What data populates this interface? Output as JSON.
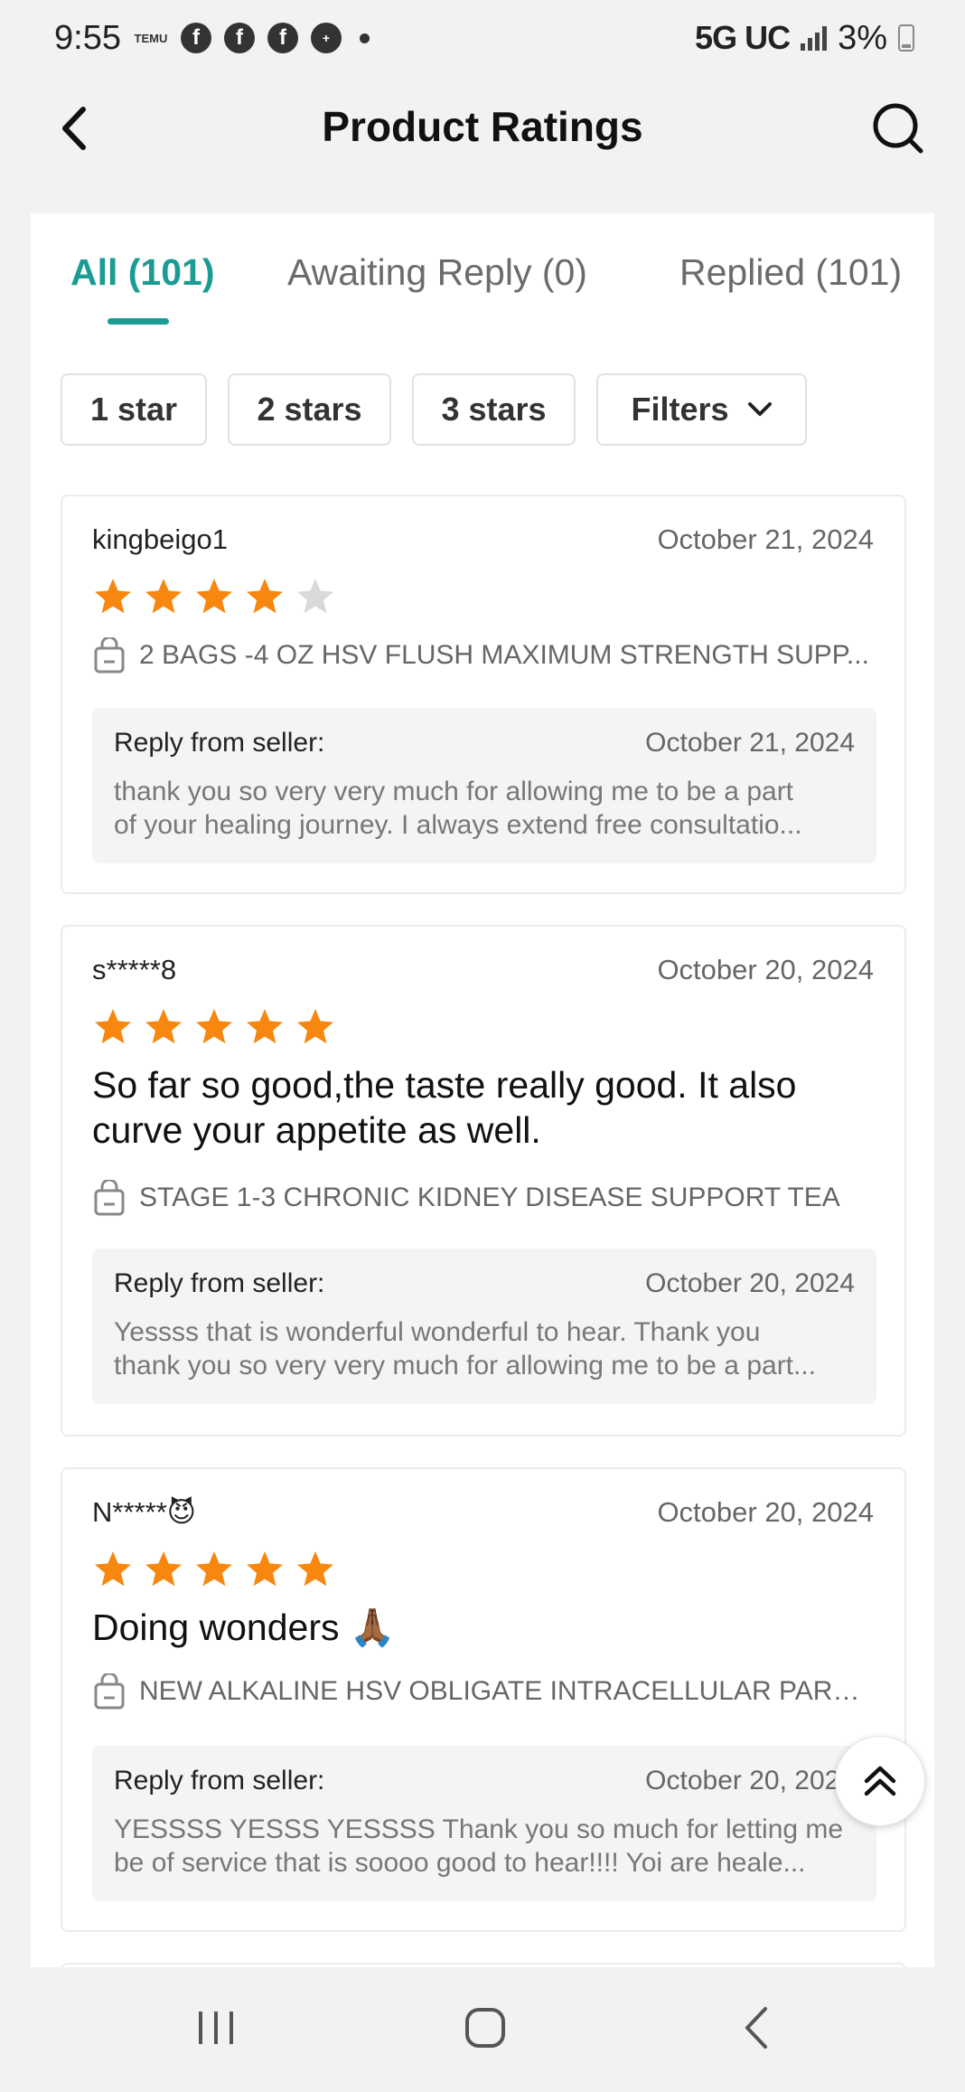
{
  "status_bar": {
    "time": "9:55",
    "temu_label": "TEMU",
    "network": "5G UC",
    "battery": "3%",
    "app_icons": [
      "temu-icon",
      "facebook-icon",
      "facebook-icon",
      "facebook-icon",
      "app-icon"
    ]
  },
  "header": {
    "title": "Product Ratings",
    "back_icon": "chevron-left-icon",
    "search_icon": "search-icon"
  },
  "tabs": [
    {
      "label": "All (101)",
      "active": true
    },
    {
      "label": "Awaiting Reply (0)",
      "active": false
    },
    {
      "label": "Replied (101)",
      "active": false
    }
  ],
  "filters": {
    "chips": [
      "1 star",
      "2 stars",
      "3 stars"
    ],
    "filters_label": "Filters"
  },
  "reviews": [
    {
      "user": "kingbeigo1",
      "date": "October 21, 2024",
      "rating": 4,
      "text": "",
      "product": "2 BAGS -4 OZ HSV FLUSH MAXIMUM STRENGTH SUPP...",
      "reply_label": "Reply from seller:",
      "reply_date": "October 21, 2024",
      "reply_line1": "thank you so very very much for allowing me to be a part",
      "reply_line2": "of your healing journey.  I always extend free consultatio..."
    },
    {
      "user": "s*****8",
      "date": "October 20, 2024",
      "rating": 5,
      "text": "So far so good,the taste really good.  It also curve your appetite as well.",
      "product": "STAGE 1-3 CHRONIC KIDNEY DISEASE SUPPORT TEA",
      "reply_label": "Reply from seller:",
      "reply_date": "October 20, 2024",
      "reply_line1": "Yessss that is wonderful wonderful to hear. Thank you",
      "reply_line2": "thank you so very very much for allowing me to be a part..."
    },
    {
      "user": "N*****😈",
      "date": "October 20, 2024",
      "rating": 5,
      "text": "Doing wonders 🙏🏾",
      "product": "NEW ALKALINE HSV OBLIGATE INTRACELLULAR PARAS...",
      "reply_label": "Reply from seller:",
      "reply_date": "October 20, 2024",
      "reply_line1": "YESSSS YESSS YESSSS Thank you so much for letting me",
      "reply_line2": "be of service that is soooo good to hear!!!! Yoi are heale..."
    }
  ],
  "colors": {
    "accent": "#1a9c93",
    "star_filled": "#f7870f",
    "star_empty": "#d9d9d9"
  }
}
